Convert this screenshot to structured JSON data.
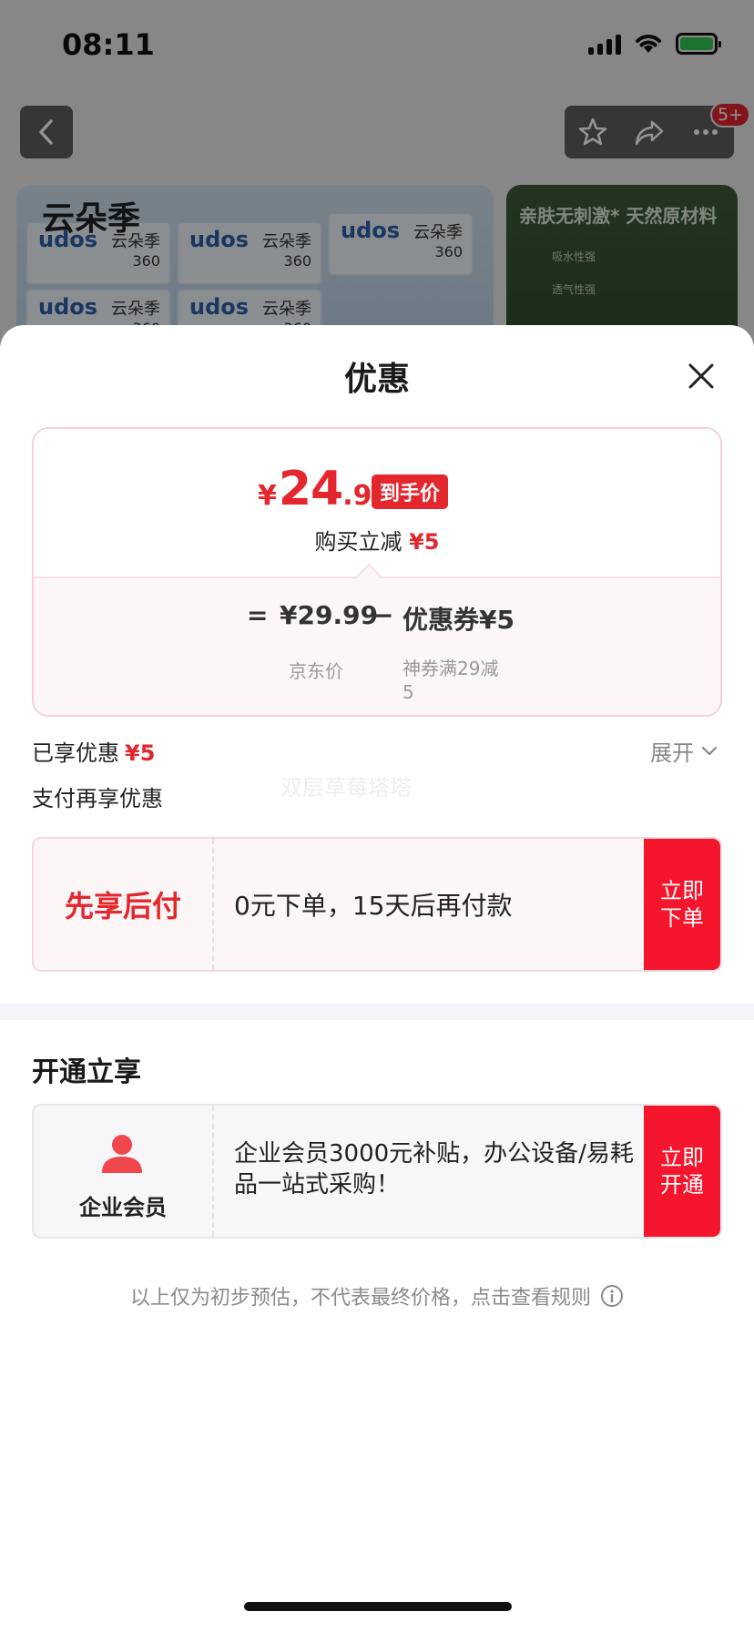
{
  "status_bar": {
    "time": "08:11"
  },
  "nav": {
    "badge": "5+"
  },
  "banner": {
    "brand": "云朵季",
    "pack_logo": "udos",
    "pack_sub": "云朵季",
    "pack_num": "360",
    "side_text": "亲肤无刺激* 天然原材料",
    "side_line1": "吸水性强",
    "side_line2": "透气性强"
  },
  "sheet": {
    "title": "优惠",
    "price": {
      "currency": "¥",
      "integer": "24",
      "decimal": ".99",
      "tag": "到手价",
      "instant_cut_label": "购买立减",
      "instant_cut_value": "¥5",
      "equals": "=",
      "jd_price": "¥29.99",
      "minus": "−",
      "coupon": "优惠券¥5",
      "jd_label": "京东价",
      "coupon_desc": "神券满29减5"
    },
    "enjoyed_label": "已享优惠",
    "enjoyed_value": "¥5",
    "expand_label": "展开",
    "pay_more_label": "支付再享优惠",
    "watermark": "双层草莓塔塔",
    "pay_later": {
      "name": "先享后付",
      "text": "0元下单，15天后再付款",
      "button": "立即下单"
    },
    "open_section_title": "开通立享",
    "member": {
      "label": "企业会员",
      "text": "企业会员3000元补贴，办公设备/易耗品一站式采购！",
      "button": "立即开通"
    },
    "disclaimer": "以上仅为初步预估，不代表最终价格，点击查看规则"
  },
  "colors": {
    "accent_red": "#e4262d",
    "button_red": "#f5152c"
  }
}
